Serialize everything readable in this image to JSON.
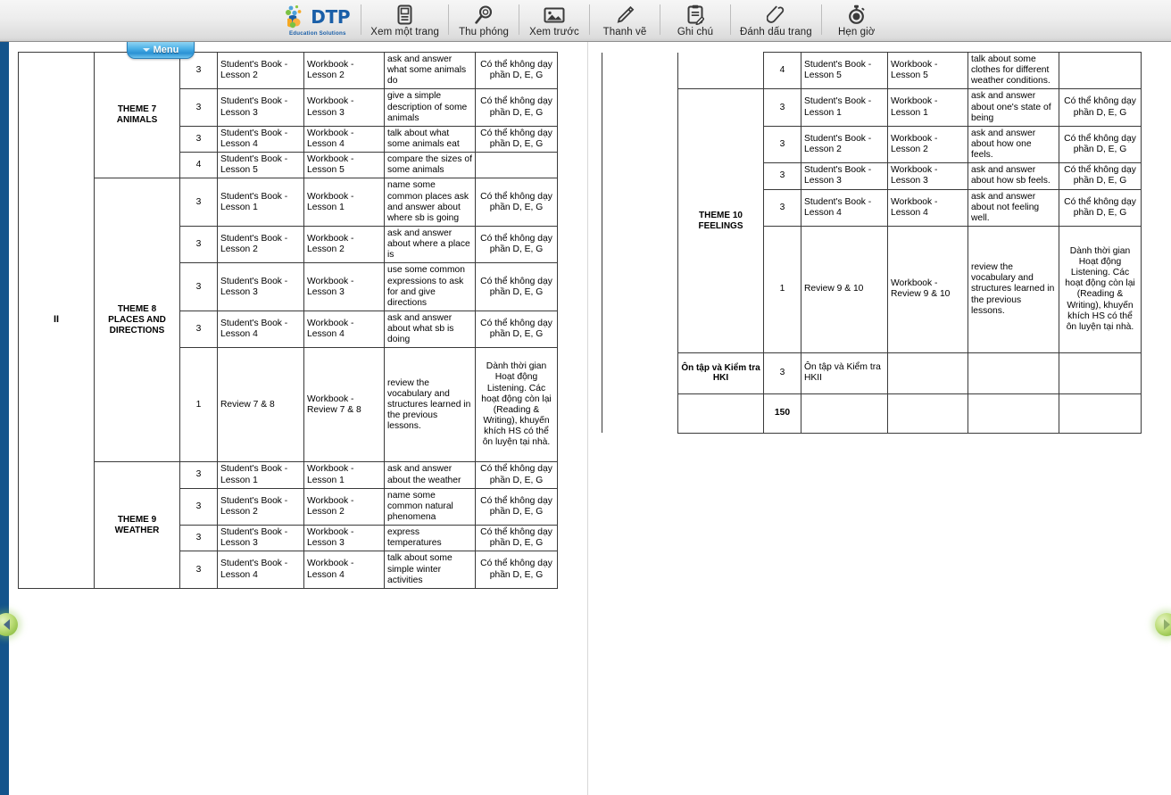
{
  "toolbar": {
    "logo": {
      "word": "DTP",
      "tagline": "Education Solutions"
    },
    "items": [
      {
        "label": "Xem một trang",
        "icon": "single-page-icon"
      },
      {
        "label": "Thu phóng",
        "icon": "magnifier-icon"
      },
      {
        "label": "Xem trước",
        "icon": "preview-image-icon"
      },
      {
        "label": "Thanh vẽ",
        "icon": "pencil-icon"
      },
      {
        "label": "Ghi chú",
        "icon": "clipboard-note-icon"
      },
      {
        "label": "Đánh dấu trang",
        "icon": "paperclip-bookmark-icon"
      },
      {
        "label": "Hẹn giờ",
        "icon": "stopwatch-timer-icon"
      }
    ]
  },
  "menu_tab": {
    "label": "Menu",
    "icon": "chevron-down-icon"
  },
  "nav": {
    "prev_icon": "arrow-left-icon",
    "next_icon": "arrow-right-icon"
  },
  "colors": {
    "rail": "#14548c",
    "total_row": "#fae0cf",
    "menu_tab": "#2a91d4",
    "logo": "#1a5fa8"
  },
  "left_page": {
    "section_label": "II",
    "themes": [
      {
        "name": "THEME 7\nANIMALS",
        "rows": [
          {
            "periods": "3",
            "sb": "Student's Book - Lesson 2",
            "wb": "Workbook - Lesson 2",
            "objective": "ask and answer what some animals do",
            "note": "Có thể không dạy phần D, E, G"
          },
          {
            "periods": "3",
            "sb": "Student's Book - Lesson 3",
            "wb": "Workbook - Lesson 3",
            "objective": "give a simple description of some animals",
            "note": "Có thể không dạy phần D, E, G"
          },
          {
            "periods": "3",
            "sb": "Student's Book - Lesson 4",
            "wb": "Workbook - Lesson 4",
            "objective": "talk about what some animals eat",
            "note": "Có thể không dạy phần D, E, G"
          },
          {
            "periods": "4",
            "sb": "Student's Book - Lesson 5",
            "wb": "Workbook - Lesson 5",
            "objective": "compare the sizes of some animals",
            "note": ""
          }
        ]
      },
      {
        "name": "THEME 8\nPLACES AND\nDIRECTIONS",
        "rows": [
          {
            "periods": "3",
            "sb": "Student's Book - Lesson 1",
            "wb": "Workbook - Lesson 1",
            "objective": "name some common places ask and answer about where sb is going",
            "note": "Có thể không dạy phần D, E, G"
          },
          {
            "periods": "3",
            "sb": "Student's Book - Lesson 2",
            "wb": "Workbook - Lesson 2",
            "objective": "ask and answer about where a place is",
            "note": "Có thể không dạy phần D, E, G"
          },
          {
            "periods": "3",
            "sb": "Student's Book - Lesson 3",
            "wb": "Workbook - Lesson 3",
            "objective": "use some common expressions to ask for and give directions",
            "note": "Có thể không dạy phần D, E, G"
          },
          {
            "periods": "3",
            "sb": "Student's Book - Lesson 4",
            "wb": "Workbook - Lesson 4",
            "objective": "ask and answer about what sb is doing",
            "note": "Có thể không dạy phần D, E, G"
          },
          {
            "periods": "1",
            "sb": "Review 7 & 8",
            "wb": "Workbook - Review 7 & 8",
            "objective": "review the vocabulary and structures learned in the previous lessons.",
            "note": "Dành thời gian Hoạt động Listening. Các hoạt động còn lại (Reading & Writing), khuyến khích HS có thể ôn luyện tại nhà."
          }
        ]
      },
      {
        "name": "THEME 9\nWEATHER",
        "rows": [
          {
            "periods": "3",
            "sb": "Student's Book - Lesson 1",
            "wb": "Workbook - Lesson 1",
            "objective": "ask and answer about the weather",
            "note": "Có thể không dạy phần D, E, G"
          },
          {
            "periods": "3",
            "sb": "Student's Book - Lesson 2",
            "wb": "Workbook - Lesson 2",
            "objective": "name some common natural phenomena",
            "note": "Có thể không dạy phần D, E, G"
          },
          {
            "periods": "3",
            "sb": "Student's Book - Lesson 3",
            "wb": "Workbook - Lesson 3",
            "objective": "express temperatures",
            "note": "Có thể không dạy phần D, E, G"
          },
          {
            "periods": "3",
            "sb": "Student's Book - Lesson 4",
            "wb": "Workbook - Lesson 4",
            "objective": "talk about some simple winter activities",
            "note": "Có thể không dạy phần D, E, G"
          }
        ]
      }
    ]
  },
  "right_page": {
    "theme9_tail": [
      {
        "periods": "4",
        "sb": "Student's Book - Lesson 5",
        "wb": "Workbook - Lesson 5",
        "objective": "talk about some clothes for different weather conditions.",
        "note": ""
      }
    ],
    "theme10": {
      "name": "THEME 10\nFEELINGS",
      "rows": [
        {
          "periods": "3",
          "sb": "Student's Book - Lesson 1",
          "wb": "Workbook - Lesson 1",
          "objective": "ask and answer about one's state of being",
          "note": "Có thể không dạy phần D, E, G"
        },
        {
          "periods": "3",
          "sb": "Student's Book - Lesson 2",
          "wb": "Workbook - Lesson 2",
          "objective": "ask and answer about how one feels.",
          "note": "Có thể không dạy phần D, E, G"
        },
        {
          "periods": "3",
          "sb": "Student's Book - Lesson 3",
          "wb": "Workbook - Lesson 3",
          "objective": "ask and answer about how sb feels.",
          "note": "Có thể không dạy phần D, E, G"
        },
        {
          "periods": "3",
          "sb": "Student's Book - Lesson 4",
          "wb": "Workbook - Lesson 4",
          "objective": "ask and answer about not feeling well.",
          "note": "Có thể không dạy phần D, E, G"
        },
        {
          "periods": "1",
          "sb": "Review 9 & 10",
          "wb": "Workbook - Review 9 & 10",
          "objective": "review the vocabulary and structures learned in the previous lessons.",
          "note": "Dành thời gian Hoạt động Listening. Các hoạt động còn lại (Reading & Writing), khuyến khích HS có thể ôn luyện tại nhà."
        }
      ]
    },
    "review_row": {
      "label": "Ôn tập và Kiểm tra HKI",
      "periods": "3",
      "sb": "Ôn tập và Kiểm tra HKII",
      "wb": "",
      "objective": "",
      "note": ""
    },
    "total_row": {
      "periods": "150"
    }
  }
}
